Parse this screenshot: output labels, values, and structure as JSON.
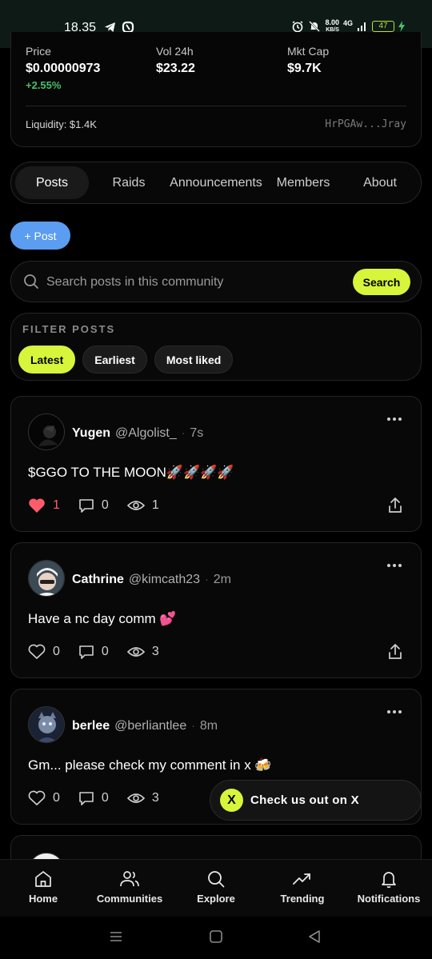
{
  "status_bar": {
    "time": "18.35",
    "speed_value": "8.00",
    "speed_unit": "KB/S",
    "network": "4G",
    "battery": "47"
  },
  "token_stats": {
    "price_label": "Price",
    "price_value": "$0.00000973",
    "price_change": "+2.55%",
    "volume_label": "Vol 24h",
    "volume_value": "$23.22",
    "mktcap_label": "Mkt Cap",
    "mktcap_value": "$9.7K",
    "liquidity": "Liquidity: $1.4K",
    "address": "HrPGAw...Jray",
    "change_color": "#47c16a"
  },
  "tabs": [
    {
      "label": "Posts",
      "active": true
    },
    {
      "label": "Raids",
      "active": false
    },
    {
      "label": "Announcements",
      "active": false
    },
    {
      "label": "Members",
      "active": false
    },
    {
      "label": "About",
      "active": false
    }
  ],
  "post_button_label": "+ Post",
  "search": {
    "placeholder": "Search posts in this community",
    "button_label": "Search"
  },
  "filter": {
    "title": "FILTER POSTS",
    "options": [
      {
        "label": "Latest",
        "active": true
      },
      {
        "label": "Earliest",
        "active": false
      },
      {
        "label": "Most liked",
        "active": false
      }
    ]
  },
  "posts": [
    {
      "name": "Yugen",
      "handle": "@Algolist_",
      "time": "7s",
      "text": "$GGO TO THE MOON🚀🚀🚀🚀",
      "likes": "1",
      "comments": "0",
      "views": "1",
      "liked": true
    },
    {
      "name": "Cathrine",
      "handle": "@kimcath23",
      "time": "2m",
      "text": "Have a nc day comm 💕",
      "likes": "0",
      "comments": "0",
      "views": "3",
      "liked": false
    },
    {
      "name": "berlee",
      "handle": "@berliantlee",
      "time": "8m",
      "text": "Gm... please check my comment in x 🍻",
      "likes": "0",
      "comments": "0",
      "views": "3",
      "liked": false
    }
  ],
  "x_promo": {
    "icon": "X",
    "label": "Check us out on X"
  },
  "bottom_nav": [
    {
      "label": "Home",
      "icon": "home-icon"
    },
    {
      "label": "Communities",
      "icon": "users-icon"
    },
    {
      "label": "Explore",
      "icon": "search-icon"
    },
    {
      "label": "Trending",
      "icon": "trending-icon"
    },
    {
      "label": "Notifications",
      "icon": "bell-icon"
    }
  ],
  "colors": {
    "accent": "#d6f53b",
    "post_button": "#5b9df1",
    "like": "#ff5c6b"
  }
}
